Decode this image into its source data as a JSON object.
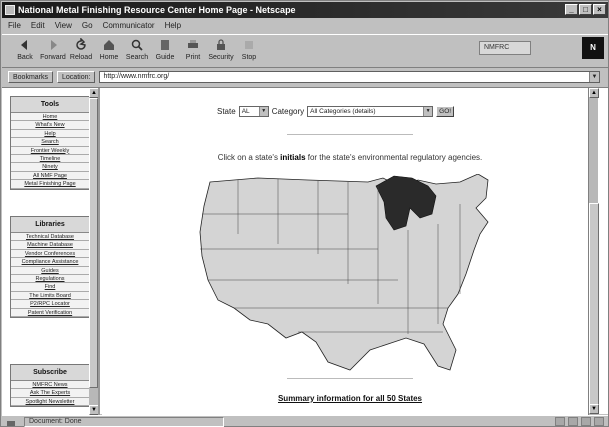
{
  "window": {
    "title": "National Metal Finishing Resource Center Home Page - Netscape",
    "minimize": "_",
    "maximize": "□",
    "close": "×"
  },
  "menu": [
    "File",
    "Edit",
    "View",
    "Go",
    "Communicator",
    "Help"
  ],
  "toolbar": {
    "buttons": [
      {
        "label": "Back",
        "icon": "back-arrow-icon"
      },
      {
        "label": "Forward",
        "icon": "forward-arrow-icon"
      },
      {
        "label": "Reload",
        "icon": "reload-icon"
      },
      {
        "label": "Home",
        "icon": "home-icon"
      },
      {
        "label": "Search",
        "icon": "search-icon"
      },
      {
        "label": "Guide",
        "icon": "guide-icon"
      },
      {
        "label": "Print",
        "icon": "print-icon"
      },
      {
        "label": "Security",
        "icon": "security-lock-icon"
      },
      {
        "label": "Stop",
        "icon": "stop-icon"
      }
    ],
    "netscape_logo": "N",
    "side_field": "NMFRC"
  },
  "location": {
    "bookmarks_label": "Bookmarks",
    "location_label": "Location:",
    "url": "http://www.nmfrc.org/"
  },
  "sidebar": {
    "sections": [
      {
        "heading": "Tools",
        "items": [
          "Home",
          "What's New",
          "Help",
          "Search",
          "Frontier Weekly",
          "Timeline",
          "Ninety",
          "All NMF Page",
          "Metal Finishing Page"
        ]
      },
      {
        "heading": "Libraries",
        "items": [
          "Technical Database",
          "Machine Database",
          "Vendor Conferences",
          "Compliance Assistance",
          "Guides",
          "Regulations",
          "Find",
          "The Limits Board",
          "P2/RPC Locator",
          "Patent Verification"
        ]
      },
      {
        "heading": "Subscribe",
        "items": [
          "NMFRC News",
          "Ask The Experts",
          "Spotlight Newsletter"
        ]
      }
    ]
  },
  "form": {
    "state_label": "State",
    "state_value": "AL",
    "category_label": "Category",
    "category_value": "All Categories (details)",
    "go_label": "GO!"
  },
  "instruction": {
    "prefix": "Click on a state's",
    "bold": "initials",
    "suffix": "for the state's environmental regulatory agencies."
  },
  "summary_link": "Summary information for all 50 States",
  "status": {
    "text": "Document: Done"
  },
  "colors": {
    "map_fill": "#d4d4d4",
    "map_highlight": "#2a2a2a",
    "titlebar": "#1a1a1a"
  }
}
